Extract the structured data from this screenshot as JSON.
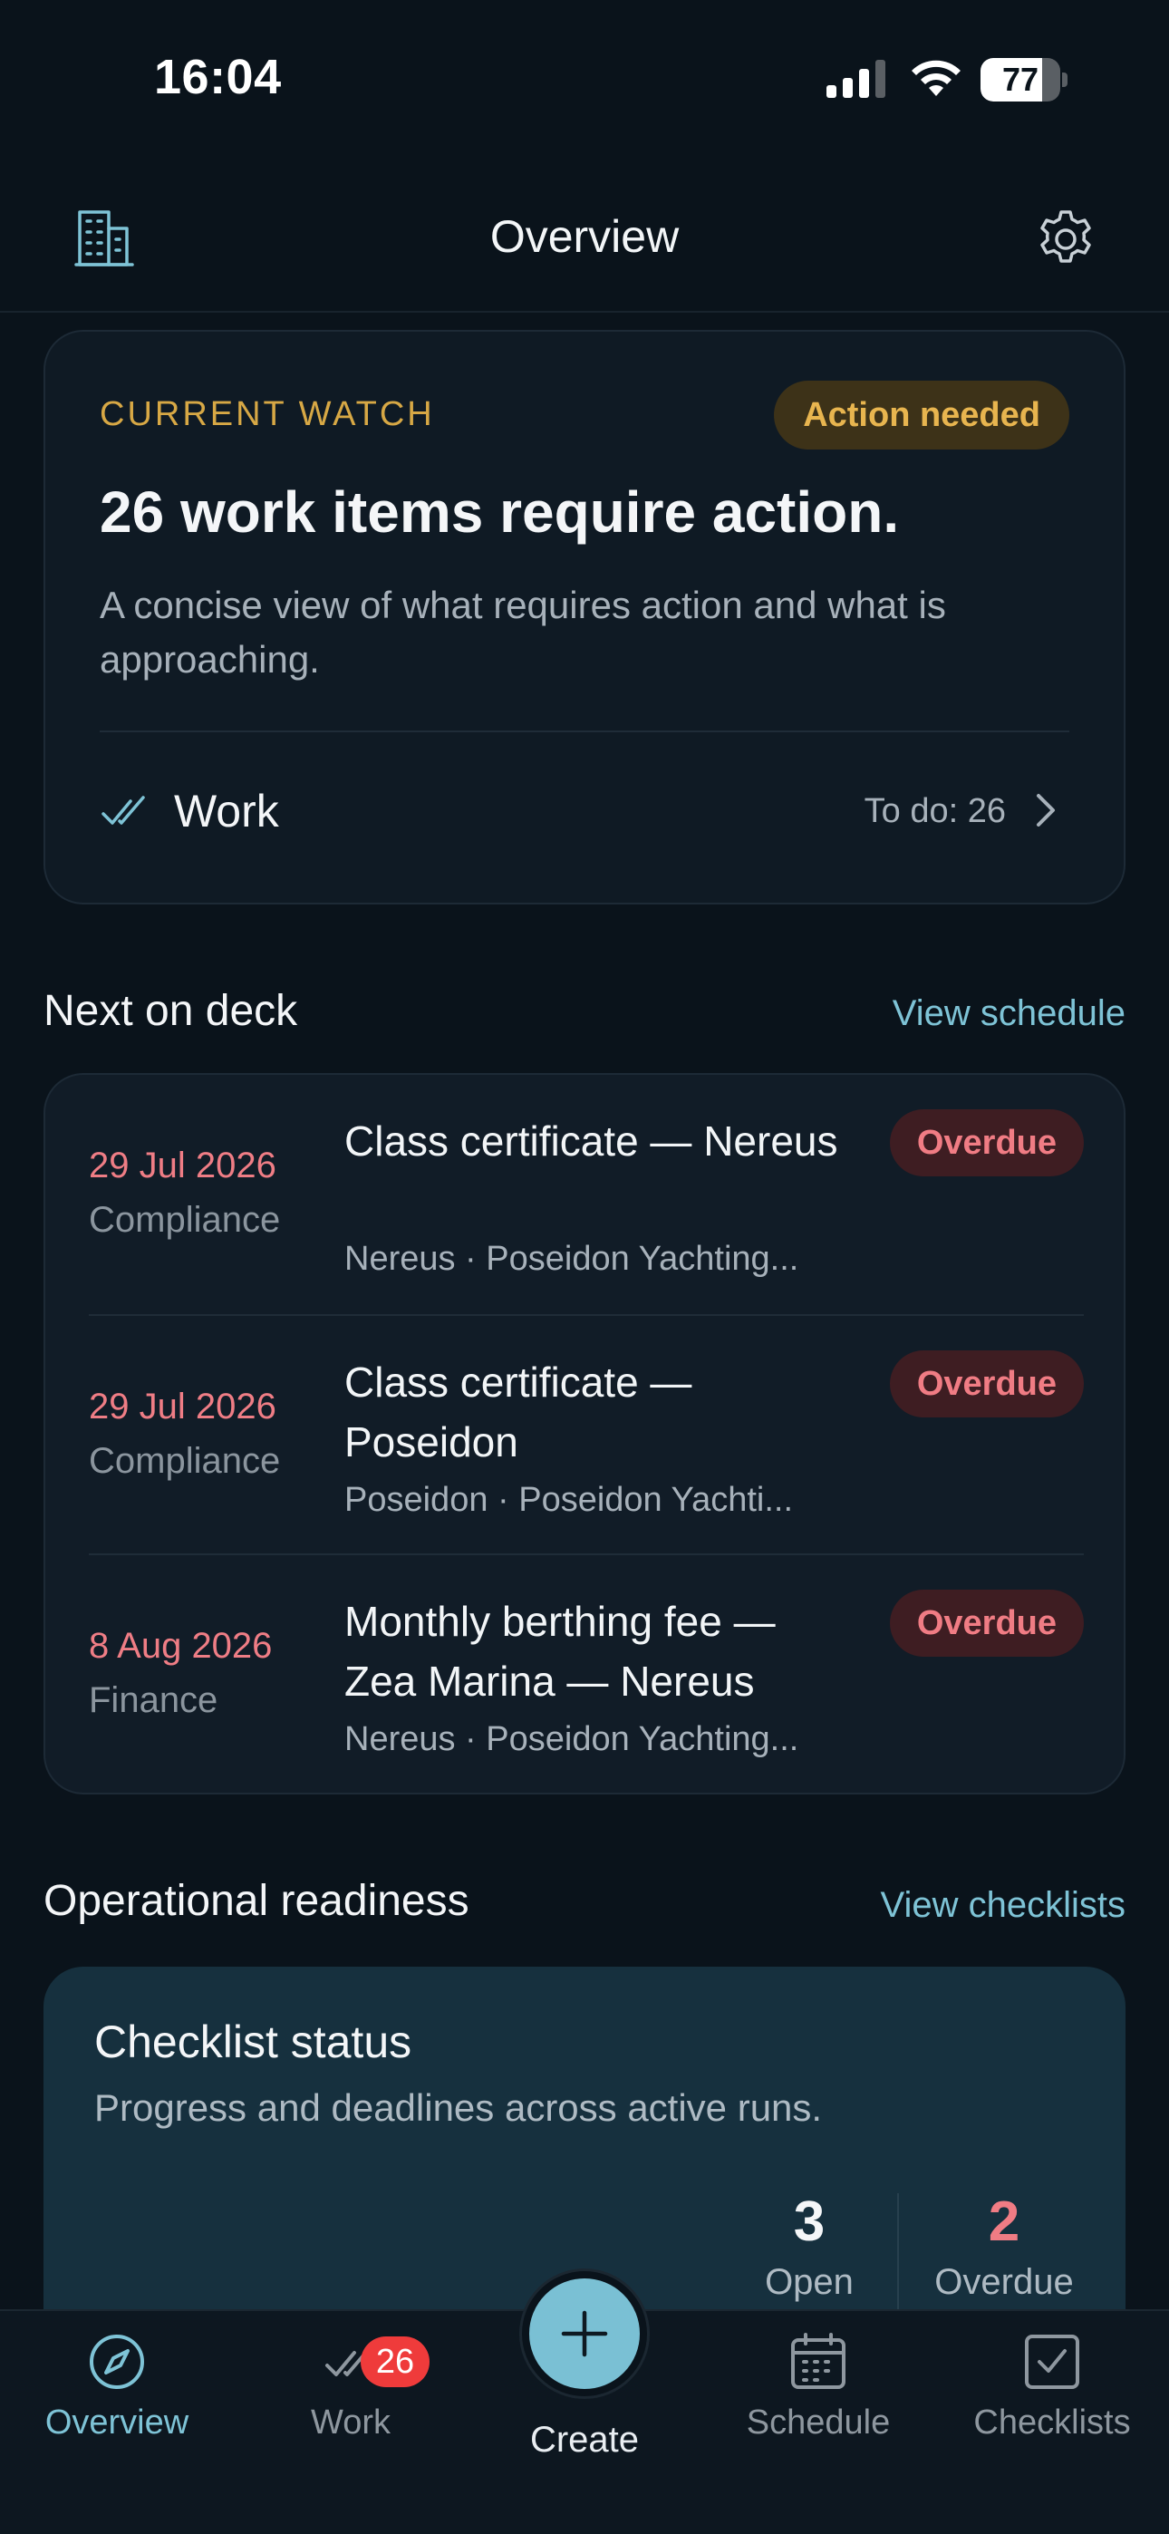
{
  "status_bar": {
    "time": "16:04",
    "battery_level": "77",
    "battery_fraction": 0.77
  },
  "nav": {
    "title": "Overview",
    "left_icon": "building-icon",
    "right_icon": "gear-icon"
  },
  "watch": {
    "eyebrow": "CURRENT WATCH",
    "badge": "Action needed",
    "headline": "26 work items require action.",
    "description": "A concise view of what requires action and what is approaching.",
    "work_label": "Work",
    "work_count": "To do: 26",
    "accent_color": "#d7a845"
  },
  "next_on_deck": {
    "title": "Next on deck",
    "link": "View schedule",
    "items": [
      {
        "date": "29 Jul 2026",
        "category": "Compliance",
        "title": "Class certificate — Nereus",
        "subtitle": "Nereus · Poseidon Yachting...",
        "status": "Overdue"
      },
      {
        "date": "29 Jul 2026",
        "category": "Compliance",
        "title": "Class certificate — Poseidon",
        "subtitle": "Poseidon · Poseidon Yachti...",
        "status": "Overdue"
      },
      {
        "date": "8 Aug 2026",
        "category": "Finance",
        "title": "Monthly berthing fee — Zea Marina — Nereus",
        "subtitle": "Nereus · Poseidon Yachting...",
        "status": "Overdue"
      }
    ]
  },
  "readiness": {
    "title": "Operational readiness",
    "link": "View checklists",
    "card_title": "Checklist status",
    "card_desc": "Progress and deadlines across active runs.",
    "stats": [
      {
        "value": "3",
        "label": "Open"
      },
      {
        "value": "2",
        "label": "Overdue"
      }
    ]
  },
  "tabs": [
    {
      "label": "Overview",
      "icon": "compass-icon",
      "active": true
    },
    {
      "label": "Work",
      "icon": "double-check-icon",
      "badge": "26"
    },
    {
      "label": "Create",
      "icon": "plus-icon"
    },
    {
      "label": "Schedule",
      "icon": "calendar-icon"
    },
    {
      "label": "Checklists",
      "icon": "checkbox-icon"
    }
  ],
  "colors": {
    "accent": "#7ec3d6",
    "overdue": "#f07c84",
    "warning": "#e8b54f",
    "background": "#0a131b"
  }
}
